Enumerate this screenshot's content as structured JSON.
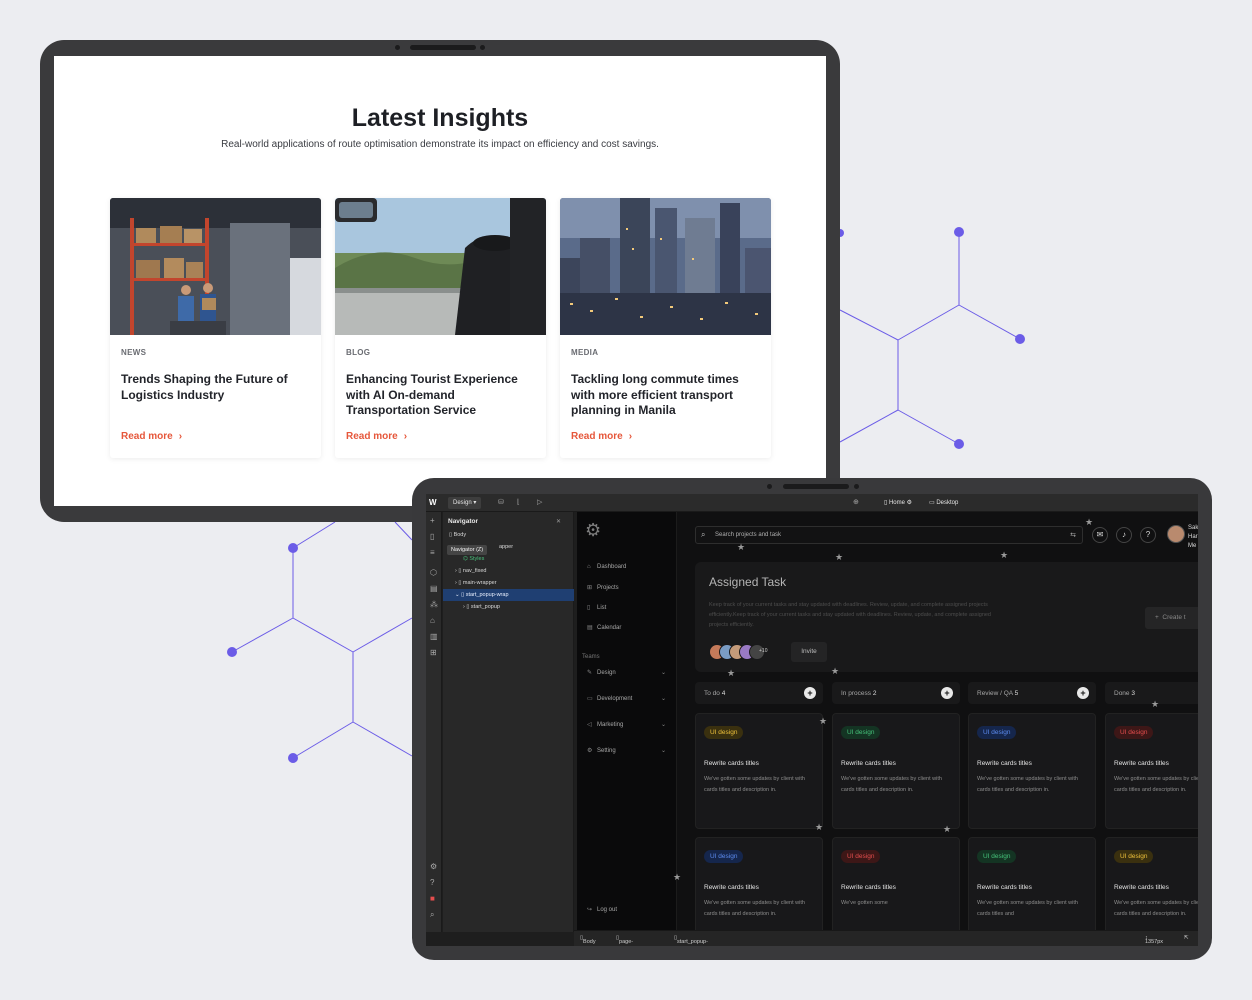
{
  "insights": {
    "title": "Latest Insights",
    "subtitle": "Real-world applications of route optimisation demonstrate its impact on efficiency and cost savings.",
    "cards": [
      {
        "category": "NEWS",
        "title": "Trends Shaping the Future of Logistics Industry",
        "link": "Read more"
      },
      {
        "category": "BLOG",
        "title": "Enhancing Tourist Experience with AI On-demand Transportation Service",
        "link": "Read more"
      },
      {
        "category": "MEDIA",
        "title": "Tackling long commute times with more efficient transport planning in Manila",
        "link": "Read more"
      }
    ]
  },
  "editor": {
    "logo": "W",
    "mode": "Design",
    "page": "Home",
    "breakpoint": "Desktop",
    "navigator": {
      "title": "Navigator",
      "tooltip": "Navigator (Z)",
      "items": [
        {
          "label": "Body",
          "selected": false
        },
        {
          "label": "apper",
          "selected": false
        },
        {
          "label": "Styles",
          "selected": false
        },
        {
          "label": "nav_fixed",
          "selected": false
        },
        {
          "label": "main-wrapper",
          "selected": false
        },
        {
          "label": "start_popup-wrap",
          "selected": true
        },
        {
          "label": "start_popup",
          "selected": false
        }
      ]
    },
    "breadcrumbs": [
      "Body",
      "page-wrapper",
      "start_popup-wrap"
    ],
    "width_readout": "1357px"
  },
  "app": {
    "sidebar": {
      "items": [
        {
          "label": "Dashboard",
          "icon": "home-icon"
        },
        {
          "label": "Projects",
          "icon": "grid-icon"
        },
        {
          "label": "List",
          "icon": "list-icon"
        },
        {
          "label": "Calendar",
          "icon": "calendar-icon"
        }
      ],
      "teams_label": "Teams",
      "teams": [
        {
          "label": "Design",
          "icon": "brush-icon"
        },
        {
          "label": "Development",
          "icon": "code-icon"
        },
        {
          "label": "Marketing",
          "icon": "megaphone-icon"
        },
        {
          "label": "Setting",
          "icon": "gear-icon"
        }
      ],
      "logout": "Log out"
    },
    "search_placeholder": "Search projects and task",
    "user": {
      "line1": "Sak",
      "line2": "Har",
      "line3": "Me"
    },
    "assigned": {
      "title": "Assigned Task",
      "description": "Keep track of your current tasks and stay updated with deadlines. Review, update, and complete assigned projects efficiently.Keep track of your current tasks and stay updated with deadlines. Review, update, and complete assigned projects efficiently.",
      "avatar_more": "+10",
      "invite": "Invite",
      "create": "Create t"
    },
    "columns": [
      {
        "name": "To do",
        "count": "4"
      },
      {
        "name": "In process",
        "count": "2"
      },
      {
        "name": "Review / QA",
        "count": "5"
      },
      {
        "name": "Done",
        "count": "3"
      }
    ],
    "tasks_row1": [
      {
        "tag": "UI design",
        "color": "yellow",
        "title": "Rewrite cards titles",
        "desc": "We've gotten some updates by client with cards titles and description in."
      },
      {
        "tag": "UI design",
        "color": "green",
        "title": "Rewrite cards titles",
        "desc": "We've gotten some updates by client with cards titles and description in."
      },
      {
        "tag": "UI design",
        "color": "blue",
        "title": "Rewrite cards titles",
        "desc": "We've gotten some updates by client with cards titles and description in."
      },
      {
        "tag": "UI design",
        "color": "red",
        "title": "Rewrite cards titles",
        "desc": "We've gotten some updates by client with cards titles and description in."
      }
    ],
    "tasks_row2": [
      {
        "tag": "UI design",
        "color": "blue",
        "title": "Rewrite cards titles",
        "desc": "We've gotten some updates by client with cards titles and description in."
      },
      {
        "tag": "UI design",
        "color": "red",
        "title": "Rewrite cards titles",
        "desc": "We've gotten some"
      },
      {
        "tag": "UI design",
        "color": "green",
        "title": "Rewrite cards titles",
        "desc": "We've gotten some updates by client with cards titles and"
      },
      {
        "tag": "UI design",
        "color": "yellow",
        "title": "Rewrite cards titles",
        "desc": "We've gotten some updates by client with cards titles and description in."
      }
    ]
  },
  "colors": {
    "accent": "#e6573b",
    "network": "#6b5ce7",
    "device": "#3a3a3c"
  }
}
